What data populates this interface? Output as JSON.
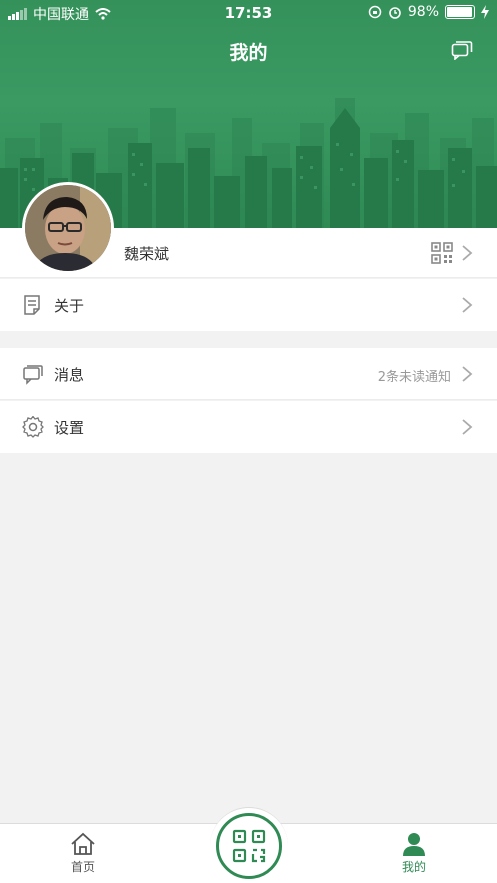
{
  "status_bar": {
    "carrier": "中国联通",
    "time": "17:53",
    "battery": "98%",
    "battery_level": 0.98
  },
  "header": {
    "title": "我的",
    "message_icon": "message-icon"
  },
  "profile": {
    "name": "魏荣斌",
    "avatar_icon": "avatar",
    "qr_icon": "qr-code-icon"
  },
  "menu": {
    "about": {
      "label": "关于",
      "icon": "document-icon"
    },
    "messages": {
      "label": "消息",
      "icon": "chat-icon",
      "extra": "2条未读通知"
    },
    "settings": {
      "label": "设置",
      "icon": "gear-icon"
    }
  },
  "tabbar": {
    "home": {
      "label": "首页",
      "icon": "home-icon"
    },
    "scan": {
      "icon": "scan-qr-icon"
    },
    "mine": {
      "label": "我的",
      "icon": "person-icon"
    },
    "active_color": "#2f8a54",
    "inactive_color": "#555555"
  },
  "colors": {
    "brand_green": "#2f8a54",
    "background": "#f2f2f2"
  }
}
